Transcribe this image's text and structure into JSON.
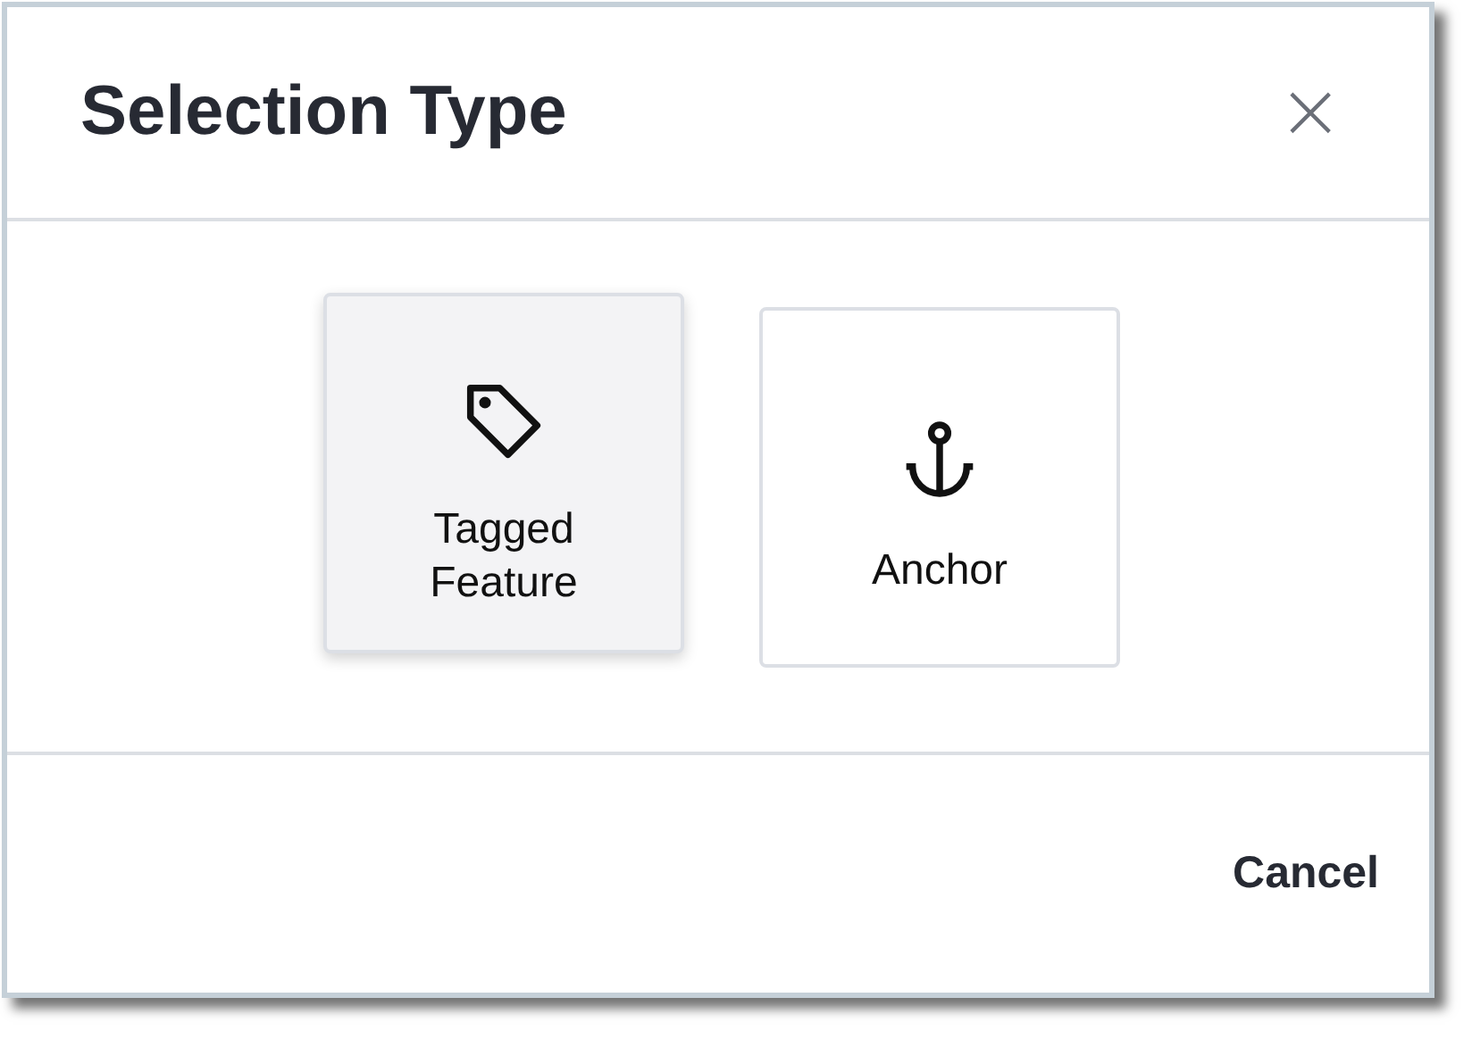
{
  "dialog": {
    "title": "Selection Type",
    "close": "×"
  },
  "options": [
    {
      "kind": "tag",
      "label": "Tagged Feature",
      "selected": true
    },
    {
      "kind": "anchor",
      "label": "Anchor",
      "selected": false
    }
  ],
  "footer": {
    "cancel": "Cancel"
  }
}
